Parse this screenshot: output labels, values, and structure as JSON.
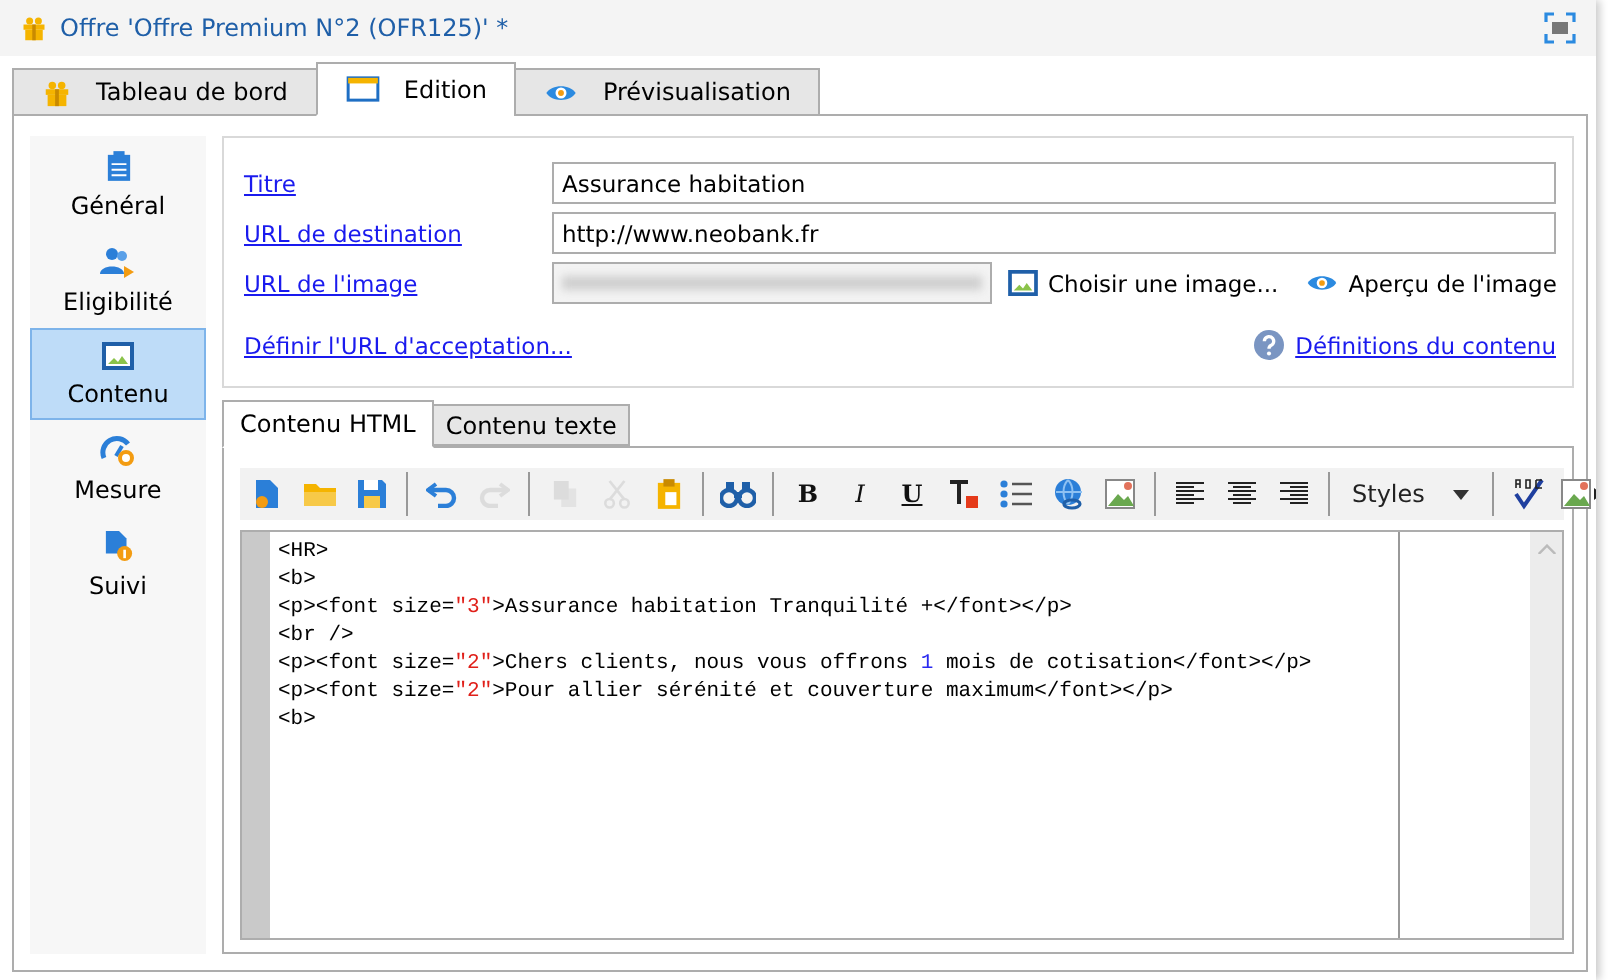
{
  "window": {
    "title": "Offre 'Offre Premium N°2 (OFR125)' *"
  },
  "tabs": [
    {
      "label": "Tableau de bord",
      "kind": "gift",
      "selected": false
    },
    {
      "label": "Edition",
      "kind": "window",
      "selected": true
    },
    {
      "label": "Prévisualisation",
      "kind": "eye",
      "selected": false
    }
  ],
  "sidebar": {
    "items": [
      {
        "label": "Général",
        "kind": "clipboard",
        "selected": false
      },
      {
        "label": "Eligibilité",
        "kind": "people",
        "selected": false
      },
      {
        "label": "Contenu",
        "kind": "picture",
        "selected": true
      },
      {
        "label": "Mesure",
        "kind": "gauge",
        "selected": false
      },
      {
        "label": "Suivi",
        "kind": "doc-info",
        "selected": false
      }
    ]
  },
  "form": {
    "fields": [
      {
        "label": "Titre",
        "kind": "text",
        "value": "Assurance habitation"
      },
      {
        "label": "URL de destination",
        "kind": "text",
        "value": "http://www.neobank.fr"
      },
      {
        "label": "URL de l'image",
        "kind": "blurred"
      }
    ],
    "choose_image": "Choisir une image...",
    "preview_image": "Aperçu de l'image",
    "acceptance_link": "Définir l'URL d'acceptation...",
    "definitions_link": "Définitions du contenu"
  },
  "editor_tabs": [
    {
      "label": "Contenu HTML",
      "selected": true
    },
    {
      "label": "Contenu texte",
      "selected": false
    }
  ],
  "toolbar": [
    {
      "kind": "new-doc",
      "disabled": false
    },
    {
      "kind": "folder",
      "disabled": false
    },
    {
      "kind": "save",
      "disabled": false
    },
    {
      "kind": "sep"
    },
    {
      "kind": "undo",
      "disabled": false
    },
    {
      "kind": "redo",
      "disabled": true
    },
    {
      "kind": "sep"
    },
    {
      "kind": "copy",
      "disabled": true
    },
    {
      "kind": "cut",
      "disabled": true
    },
    {
      "kind": "paste",
      "disabled": false
    },
    {
      "kind": "sep"
    },
    {
      "kind": "binoculars",
      "disabled": false
    },
    {
      "kind": "sep"
    },
    {
      "kind": "bold",
      "label": "B"
    },
    {
      "kind": "italic",
      "label": "I"
    },
    {
      "kind": "underline",
      "label": "U"
    },
    {
      "kind": "text-color",
      "disabled": false
    },
    {
      "kind": "list",
      "disabled": false
    },
    {
      "kind": "globe",
      "disabled": false
    },
    {
      "kind": "image",
      "disabled": false
    },
    {
      "kind": "sep"
    },
    {
      "kind": "align-left",
      "disabled": false
    },
    {
      "kind": "align-center",
      "disabled": false
    },
    {
      "kind": "align-right",
      "disabled": false
    },
    {
      "kind": "sep"
    },
    {
      "kind": "dropdown",
      "label": "Styles"
    },
    {
      "kind": "sep"
    },
    {
      "kind": "spell",
      "disabled": false
    },
    {
      "kind": "image-more",
      "disabled": false
    }
  ],
  "code_lines": [
    [
      {
        "kind": "text",
        "text": "<HR>"
      }
    ],
    [
      {
        "kind": "text",
        "text": "<b>"
      }
    ],
    [
      {
        "kind": "text",
        "text": "<p><font size="
      },
      {
        "kind": "string",
        "text": "\"3\""
      },
      {
        "kind": "text",
        "text": ">Assurance habitation Tranquilité +</font></p>"
      }
    ],
    [
      {
        "kind": "text",
        "text": "<br />"
      }
    ],
    [
      {
        "kind": "text",
        "text": "<p><font size="
      },
      {
        "kind": "string",
        "text": "\"2\""
      },
      {
        "kind": "text",
        "text": ">Chers clients, nous vous offrons "
      },
      {
        "kind": "number",
        "text": "1"
      },
      {
        "kind": "text",
        "text": " mois de cotisation</font></p>"
      }
    ],
    [
      {
        "kind": "text",
        "text": "<p><font size="
      },
      {
        "kind": "string",
        "text": "\"2\""
      },
      {
        "kind": "text",
        "text": ">Pour allier sérénité et couverture maximum</font></p>"
      }
    ],
    [
      {
        "kind": "text",
        "text": "<b>"
      }
    ]
  ]
}
